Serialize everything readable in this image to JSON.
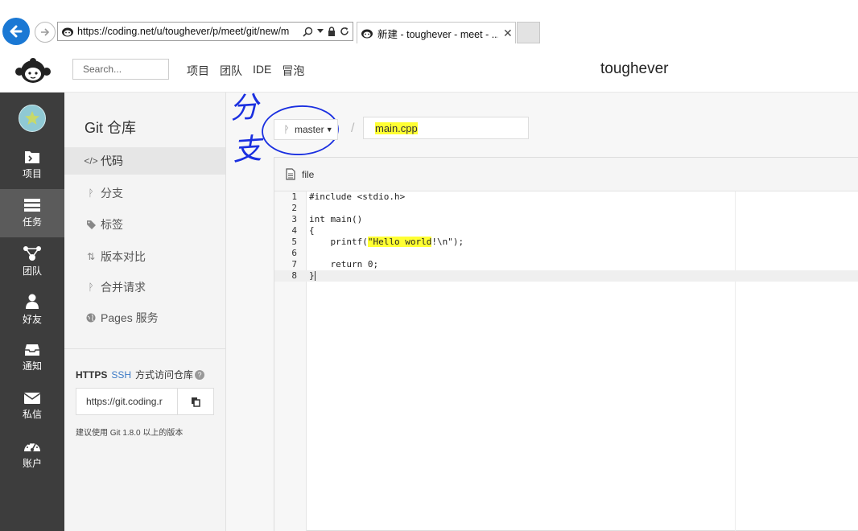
{
  "browser": {
    "url": "https://coding.net/u/toughever/p/meet/git/new/m",
    "tab_title": "新建 - toughever - meet - ..."
  },
  "header": {
    "search_placeholder": "Search...",
    "nav": [
      "项目",
      "团队",
      "IDE",
      "冒泡"
    ],
    "username": "toughever"
  },
  "leftbar": {
    "items": [
      {
        "label": "项目",
        "icon": "folder-icon"
      },
      {
        "label": "任务",
        "icon": "tasks-icon"
      },
      {
        "label": "团队",
        "icon": "team-icon"
      },
      {
        "label": "好友",
        "icon": "user-icon"
      },
      {
        "label": "通知",
        "icon": "inbox-icon"
      },
      {
        "label": "私信",
        "icon": "envelope-icon"
      },
      {
        "label": "账户",
        "icon": "dashboard-icon"
      }
    ],
    "active_index": 1
  },
  "repo": {
    "title": "Git 仓库",
    "menu": [
      {
        "label": "代码",
        "icon": "code-icon"
      },
      {
        "label": "分支",
        "icon": "branch-icon"
      },
      {
        "label": "标签",
        "icon": "tag-icon"
      },
      {
        "label": "版本对比",
        "icon": "compare-icon"
      },
      {
        "label": "合并请求",
        "icon": "merge-icon"
      },
      {
        "label": "Pages 服务",
        "icon": "globe-icon"
      }
    ],
    "active_index": 0,
    "access": {
      "https": "HTTPS",
      "ssh": "SSH",
      "suffix": "方式访问仓库",
      "clone_url": "https://git.coding.r",
      "hint": "建议使用 Git 1.8.0 以上的版本"
    }
  },
  "editor": {
    "branch": "master",
    "separator": "/",
    "filename": "main.cpp",
    "annotation": "分支",
    "file_label": "file",
    "current_line": 8,
    "lines": [
      "#include <stdio.h>",
      "",
      "int main()",
      "{",
      "    printf(\"Hello world!\\n\");",
      "",
      "    return 0;",
      "}"
    ]
  },
  "colors": {
    "highlight": "#ffff33",
    "annotation_ink": "#1a2fe0",
    "sidebar_dark": "#3d3d3d",
    "back_button": "#1a78d4"
  }
}
